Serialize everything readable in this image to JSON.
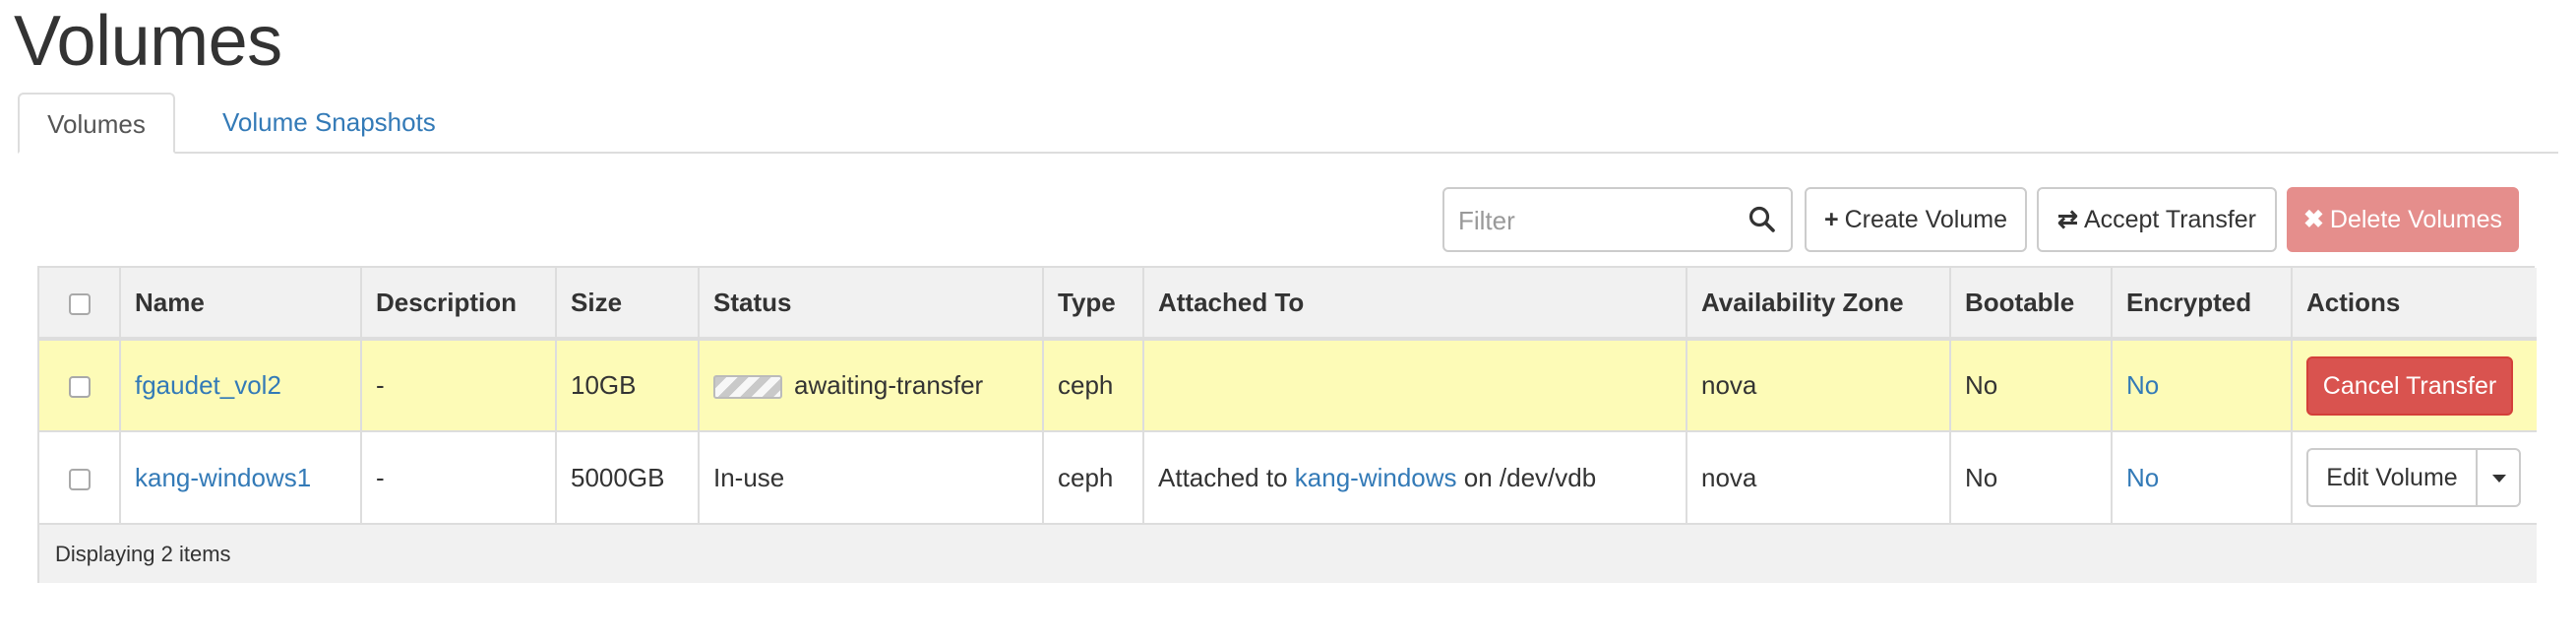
{
  "page": {
    "title": "Volumes"
  },
  "tabs": [
    {
      "label": "Volumes",
      "active": true
    },
    {
      "label": "Volume Snapshots",
      "active": false
    }
  ],
  "toolbar": {
    "filter_placeholder": "Filter",
    "create_label": "Create Volume",
    "accept_label": "Accept Transfer",
    "delete_label": "Delete Volumes",
    "delete_disabled": true,
    "icons": {
      "search": "search-icon",
      "create": "plus-icon",
      "accept": "exchange-icon",
      "delete": "close-icon"
    }
  },
  "table": {
    "headers": [
      "Name",
      "Description",
      "Size",
      "Status",
      "Type",
      "Attached To",
      "Availability Zone",
      "Bootable",
      "Encrypted",
      "Actions"
    ],
    "rows": [
      {
        "name": "fgaudet_vol2",
        "description": "-",
        "size": "10GB",
        "status": "awaiting-transfer",
        "type": "ceph",
        "attached_to": "",
        "availability_zone": "nova",
        "bootable": "No",
        "encrypted": "No",
        "action": "Cancel Transfer"
      },
      {
        "name": "kang-windows1",
        "description": "-",
        "size": "5000GB",
        "status": "In-use",
        "type": "ceph",
        "attached_prefix": "Attached to",
        "attached_link": "kang-windows",
        "attached_suffix": "on /dev/vdb",
        "availability_zone": "nova",
        "bootable": "No",
        "encrypted": "No",
        "action": "Edit Volume"
      }
    ],
    "footer": "Displaying 2 items"
  },
  "colors": {
    "link": "#337ab7",
    "highlight_row": "#fdfbb7",
    "danger": "#d9534f",
    "danger_disabled": "#e58e8c",
    "header_bg": "#f1f1f1"
  }
}
